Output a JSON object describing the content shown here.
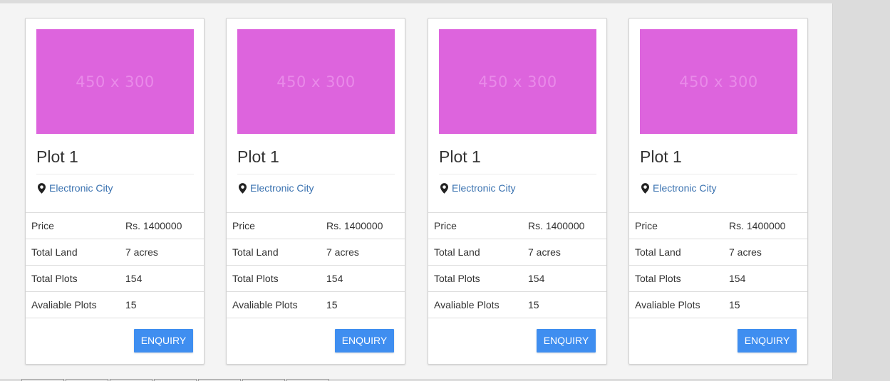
{
  "image_placeholder_text": "450 x 300",
  "colors": {
    "image_placeholder": "#dd64dd",
    "location_link": "#3a72b0",
    "enquiry_button": "#3f8ef0"
  },
  "icons": {
    "location": "map-pin-icon"
  },
  "cards": [
    {
      "title": "Plot 1",
      "location": "Electronic City",
      "specs": [
        {
          "label": "Price",
          "value": "Rs. 1400000"
        },
        {
          "label": "Total Land",
          "value": "7 acres"
        },
        {
          "label": "Total Plots",
          "value": "154"
        },
        {
          "label": "Avaliable Plots",
          "value": "15"
        }
      ],
      "button_label": "ENQUIRY"
    },
    {
      "title": "Plot 1",
      "location": "Electronic City",
      "specs": [
        {
          "label": "Price",
          "value": "Rs. 1400000"
        },
        {
          "label": "Total Land",
          "value": "7 acres"
        },
        {
          "label": "Total Plots",
          "value": "154"
        },
        {
          "label": "Avaliable Plots",
          "value": "15"
        }
      ],
      "button_label": "ENQUIRY"
    },
    {
      "title": "Plot 1",
      "location": "Electronic City",
      "specs": [
        {
          "label": "Price",
          "value": "Rs. 1400000"
        },
        {
          "label": "Total Land",
          "value": "7 acres"
        },
        {
          "label": "Total Plots",
          "value": "154"
        },
        {
          "label": "Avaliable Plots",
          "value": "15"
        }
      ],
      "button_label": "ENQUIRY"
    },
    {
      "title": "Plot 1",
      "location": "Electronic City",
      "specs": [
        {
          "label": "Price",
          "value": "Rs. 1400000"
        },
        {
          "label": "Total Land",
          "value": "7 acres"
        },
        {
          "label": "Total Plots",
          "value": "154"
        },
        {
          "label": "Avaliable Plots",
          "value": "15"
        }
      ],
      "button_label": "ENQUIRY"
    }
  ]
}
